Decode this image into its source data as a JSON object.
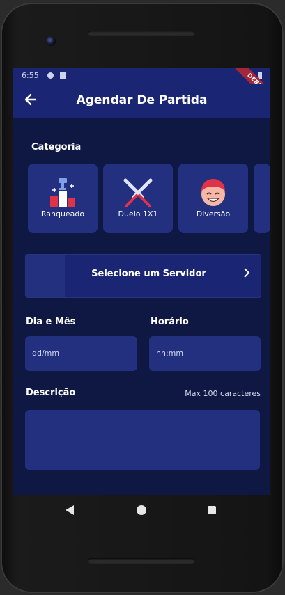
{
  "status_bar": {
    "time": "6:55",
    "debug_banner": "DEBUG"
  },
  "app_bar": {
    "title": "Agendar De Partida"
  },
  "category": {
    "label": "Categoria",
    "items": [
      {
        "label": "Ranqueado",
        "icon": "podium-icon"
      },
      {
        "label": "Duelo 1X1",
        "icon": "crossed-swords-icon"
      },
      {
        "label": "Diversão",
        "icon": "smiley-face-icon"
      }
    ]
  },
  "server": {
    "label": "Selecione um Servidor"
  },
  "date": {
    "label": "Dia e Mês",
    "placeholder": "dd/mm"
  },
  "time": {
    "label": "Horário",
    "placeholder": "hh:mm"
  },
  "description": {
    "label": "Descrição",
    "hint": "Max 100 caracteres"
  },
  "colors": {
    "background": "#0e1842",
    "app_bar": "#1a2574",
    "card": "#22307f",
    "accent_red": "#e0334a"
  }
}
